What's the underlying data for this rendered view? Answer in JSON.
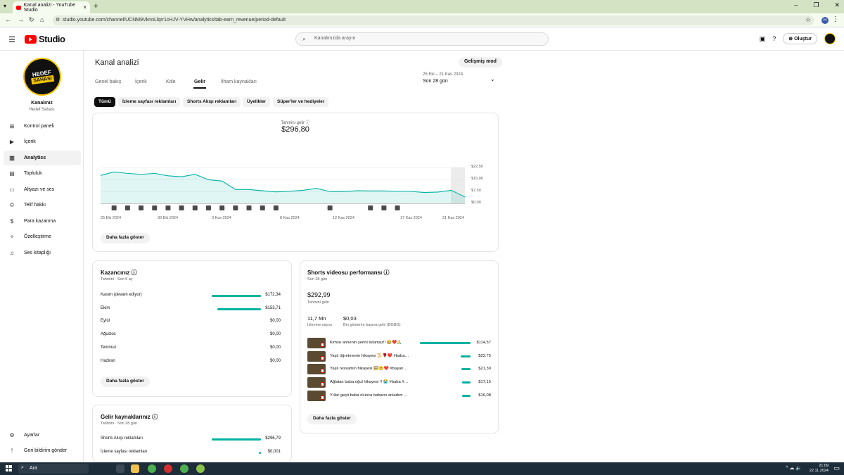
{
  "browser": {
    "tab_title": "Kanal analizi - YouTube Studio",
    "url": "studio.youtube.com/channel/UCNM9VknnLlqrr1cHJV-YVHw/analytics/tab-earn_revenue/period-default",
    "profile_initial": "H"
  },
  "header": {
    "logo": "Studio",
    "search_placeholder": "Kanalınızda arayın",
    "create_label": "Oluştur"
  },
  "sidebar": {
    "avatar_line1": "HEDEF",
    "avatar_line2": "SAHASI",
    "channel_name": "Kanalınız",
    "channel_sub": "Hedef Sahası",
    "items": [
      {
        "label": "Kontrol paneli",
        "icon": "⊞"
      },
      {
        "label": "İçerik",
        "icon": "▶"
      },
      {
        "label": "Analytics",
        "icon": "▥"
      },
      {
        "label": "Topluluk",
        "icon": "▤"
      },
      {
        "label": "Altyazı ve ses",
        "icon": "▭"
      },
      {
        "label": "Telif hakkı",
        "icon": "©"
      },
      {
        "label": "Para kazanma",
        "icon": "$"
      },
      {
        "label": "Özelleştirme",
        "icon": "✧"
      },
      {
        "label": "Ses kitaplığı",
        "icon": "♫"
      }
    ],
    "settings_label": "Ayarlar",
    "feedback_label": "Geri bildirim gönder"
  },
  "main": {
    "title": "Kanal analizi",
    "advanced_mode": "Gelişmiş mod",
    "tabs": [
      "Genel bakış",
      "İçerik",
      "Kitle",
      "Gelir",
      "İlham kaynakları"
    ],
    "active_tab": "Gelir",
    "date_range": "25 Eki – 21 Kas 2024",
    "date_value": "Son 28 gün",
    "chips": [
      "Tümü",
      "İzleme sayfası reklamları",
      "Shorts Akışı reklamları",
      "Üyelikler",
      "Süper'ler ve hediyeler"
    ],
    "revenue_label": "Tahmini gelir",
    "revenue_value": "$296,80",
    "show_more": "Daha fazla göster"
  },
  "chart_data": {
    "type": "area",
    "title": "Tahmini gelir",
    "x_ticks": [
      "25 Eki 2024",
      "30 Eki 2024",
      "3 Kas 2024",
      "8 Kas 2024",
      "12 Kas 2024",
      "17 Kas 2024",
      "21 Kas 2024"
    ],
    "y_ticks": [
      "$22,50",
      "$15,00",
      "$7,50",
      "$0,00"
    ],
    "ylim": [
      0,
      22.5
    ],
    "x": [
      "25 Eki",
      "26 Eki",
      "27 Eki",
      "28 Eki",
      "29 Eki",
      "30 Eki",
      "31 Eki",
      "1 Kas",
      "2 Kas",
      "3 Kas",
      "4 Kas",
      "5 Kas",
      "6 Kas",
      "7 Kas",
      "8 Kas",
      "9 Kas",
      "10 Kas",
      "11 Kas",
      "12 Kas",
      "13 Kas",
      "14 Kas",
      "15 Kas",
      "16 Kas",
      "17 Kas",
      "18 Kas",
      "19 Kas",
      "20 Kas",
      "21 Kas"
    ],
    "values": [
      17.5,
      19.7,
      18.8,
      18.2,
      18.8,
      17.3,
      16.7,
      18.2,
      14.8,
      14.0,
      8.7,
      8.7,
      7.9,
      7.2,
      7.6,
      8.2,
      9.4,
      7.4,
      7.4,
      7.9,
      7.8,
      7.8,
      7.5,
      7.5,
      6.8,
      7.1,
      8.2,
      4.0
    ],
    "grid": true
  },
  "earnings": {
    "title": "Kazancınız",
    "sub": "Tahmini · Son 6 ay",
    "rows": [
      {
        "label": "Kasım (devam ediyor)",
        "value": "$172,34",
        "amount": 172.34
      },
      {
        "label": "Ekim",
        "value": "$153,71",
        "amount": 153.71
      },
      {
        "label": "Eylül",
        "value": "$0,00",
        "amount": 0
      },
      {
        "label": "Ağustos",
        "value": "$0,00",
        "amount": 0
      },
      {
        "label": "Temmuz",
        "value": "$0,00",
        "amount": 0
      },
      {
        "label": "Haziran",
        "value": "$0,00",
        "amount": 0
      }
    ]
  },
  "shorts": {
    "title": "Shorts videosu performansı",
    "sub": "Son 28 gün",
    "revenue": "$292,99",
    "revenue_label": "Tahmini gelir",
    "views": "11,7 Mn",
    "views_label": "İzlenme sayısı",
    "rpm": "$0,03",
    "rpm_label": "Bin gösterim başına gelir (BGBG)",
    "videos": [
      {
        "title": "Kimse annenin yerini tutamaz!! 😂❤️🙏",
        "value": "$114,57",
        "amount": 114.57
      },
      {
        "title": "Yaşlı öğretmenin hikayesi 📜🌹❤️ #baba…",
        "value": "$22,75",
        "amount": 22.75
      },
      {
        "title": "Yaşlı ressamın hikayesi 🖼️😊❤️ #başarı…",
        "value": "$21,30",
        "amount": 21.3
      },
      {
        "title": "Ağlatan baba oğul hikayesi !! 😭 #baba #…",
        "value": "$17,15",
        "amount": 17.15
      },
      {
        "title": "Yıllar geçti baba olunca babamı anladım …",
        "value": "$16,08",
        "amount": 16.08
      }
    ]
  },
  "sources": {
    "title": "Gelir kaynaklarınız",
    "sub": "Tahmini · Son 28 gün",
    "rows": [
      {
        "label": "Shorts Akışı reklamları",
        "value": "$296,79",
        "amount": 296.79
      },
      {
        "label": "İzleme sayfası reklamları",
        "value": "$0,001",
        "amount": 0.001
      }
    ]
  },
  "taskbar": {
    "search": "Ara",
    "time": "21:09",
    "date": "22.11.2024"
  },
  "colors": {
    "accent": "#00b3a4",
    "brand": "#ff0000"
  }
}
